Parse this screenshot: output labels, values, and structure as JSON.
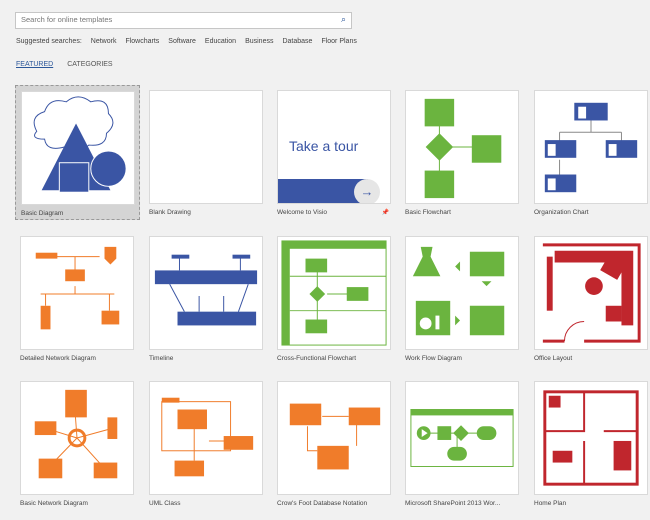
{
  "search": {
    "placeholder": "Search for online templates",
    "icon": "search-icon"
  },
  "suggested": {
    "label": "Suggested searches:",
    "items": [
      "Network",
      "Flowcharts",
      "Software",
      "Education",
      "Business",
      "Database",
      "Floor Plans"
    ]
  },
  "tabs": [
    "FEATURED",
    "CATEGORIES"
  ],
  "tour_text": "Take a tour",
  "templates": [
    "Basic Diagram",
    "Blank Drawing",
    "Welcome to Visio",
    "Basic Flowchart",
    "Organization Chart",
    "Detailed Network Diagram",
    "Timeline",
    "Cross-Functional Flowchart",
    "Work Flow Diagram",
    "Office Layout",
    "Basic Network Diagram",
    "UML Class",
    "Crow's Foot Database Notation",
    "Microsoft SharePoint 2013 Wor...",
    "Home Plan"
  ],
  "colors": {
    "blue": "#3a55a4",
    "green": "#6bb43f",
    "orange": "#f07c2a",
    "red": "#c0262d"
  }
}
